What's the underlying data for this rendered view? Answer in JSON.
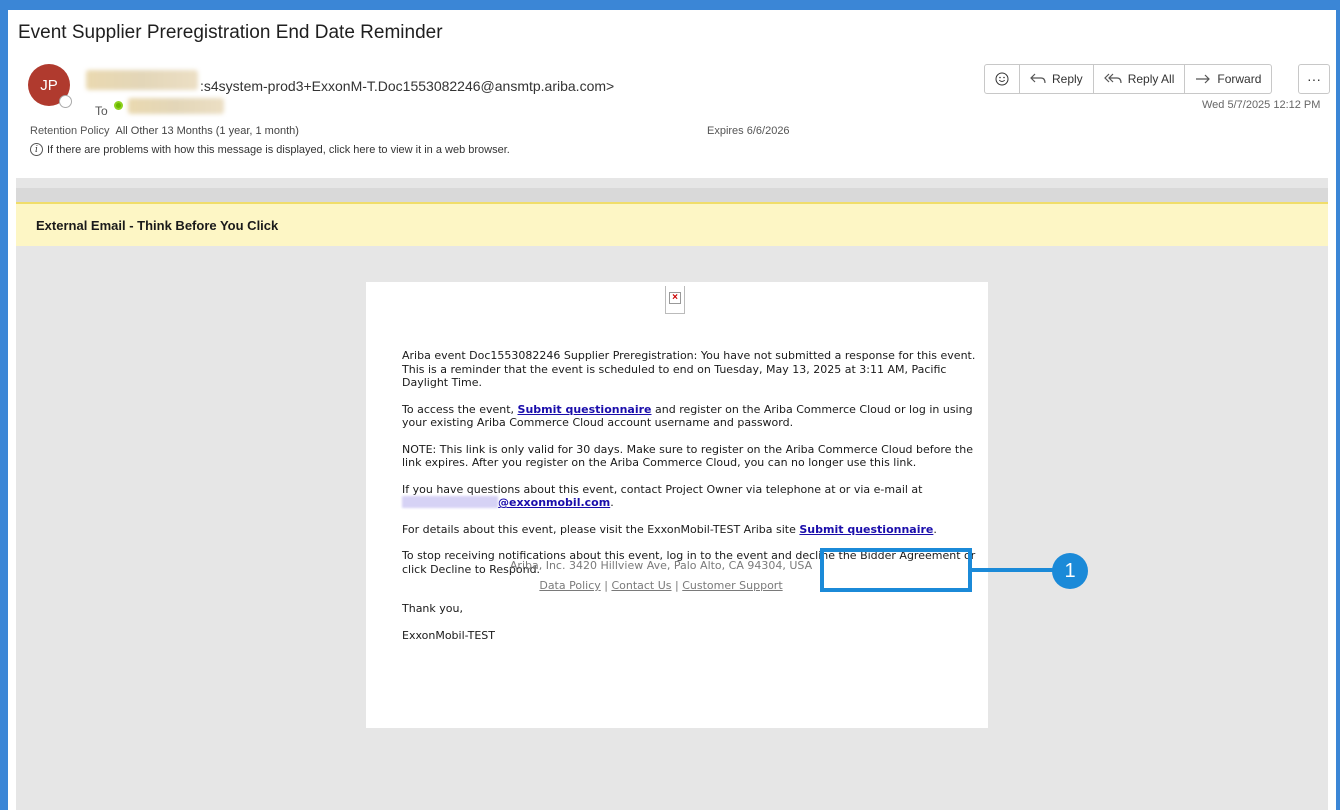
{
  "email": {
    "subject": "Event Supplier Preregistration End Date Reminder",
    "avatar_initials": "JP",
    "from_address": ":s4system-prod3+ExxonM-T.Doc1553082246@ansmtp.ariba.com>",
    "to_label": "To",
    "retention_label": "Retention Policy",
    "retention_value": "All Other 13 Months (1 year, 1 month)",
    "expires": "Expires 6/6/2026",
    "info_text": "If there are problems with how this message is displayed, click here to view it in a web browser.",
    "received_date": "Wed 5/7/2025 12:12 PM"
  },
  "toolbar": {
    "reply": "Reply",
    "reply_all": "Reply All",
    "forward": "Forward",
    "more": "···"
  },
  "banner": {
    "warning": "External Email - Think Before You Click"
  },
  "message": {
    "p1": "Ariba event Doc1553082246 Supplier Preregistration: You have not submitted a response for this event.",
    "p1b": "This is a reminder that the event is scheduled to end on Tuesday, May 13, 2025 at 3:11 AM, Pacific Daylight Time.",
    "p2_before": "To access the event, ",
    "link1": "Submit questionnaire",
    "p2_after": " and register on the Ariba Commerce Cloud or log in using your existing Ariba Commerce Cloud account username and password.",
    "p3": "NOTE: This link is only valid for 30 days. Make sure to register on the Ariba Commerce Cloud before the link expires. After you register on the Ariba Commerce Cloud, you can no longer use this link.",
    "p4": "If you have questions about this event, contact Project Owner via telephone at or via e-mail at",
    "email_domain": "@exxonmobil.com",
    "p5_before": "For details about this event, please visit the ExxonMobil-TEST Ariba site ",
    "link2": "Submit questionnaire",
    "p6": "To stop receiving notifications about this event, log in to the event and decline the Bidder Agreement or click Decline to Respond.",
    "thanks": "Thank you,",
    "signature": "ExxonMobil-TEST"
  },
  "footer": {
    "address": "Ariba, Inc. 3420 Hillview Ave, Palo Alto, CA 94304, USA",
    "data_policy": "Data Policy",
    "contact_us": "Contact Us",
    "customer_support": "Customer Support"
  },
  "annotation": {
    "step": "1"
  },
  "colors": {
    "accent": "#1b8ad8",
    "avatar": "#b03a2e",
    "warning_bg": "#fdf6c5",
    "link": "#1a0dab"
  }
}
